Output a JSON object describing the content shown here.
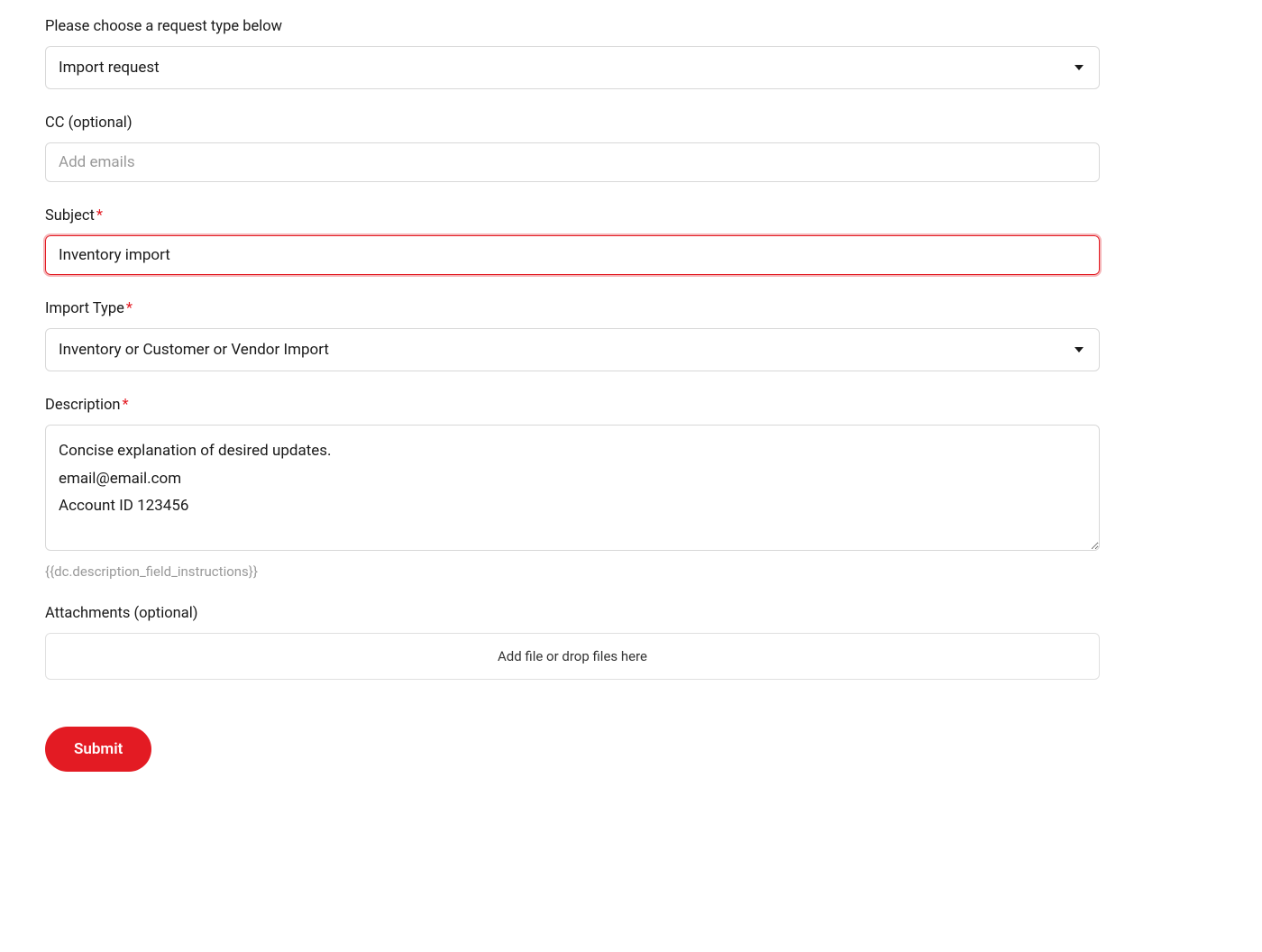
{
  "form": {
    "request_type": {
      "label": "Please choose a request type below",
      "value": "Import request"
    },
    "cc": {
      "label": "CC",
      "optional_text": "(optional)",
      "placeholder": "Add emails",
      "value": ""
    },
    "subject": {
      "label": "Subject",
      "value": "Inventory import"
    },
    "import_type": {
      "label": "Import Type",
      "value": "Inventory or Customer or Vendor Import"
    },
    "description": {
      "label": "Description",
      "value": "Concise explanation of desired updates.\nemail@email.com\nAccount ID 123456",
      "helper": "{{dc.description_field_instructions}}"
    },
    "attachments": {
      "label": "Attachments",
      "optional_text": "(optional)",
      "dropzone_text": "Add file or drop files here"
    },
    "submit_label": "Submit"
  }
}
